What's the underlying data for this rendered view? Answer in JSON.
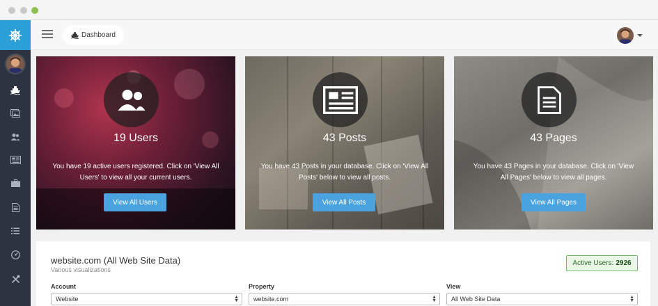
{
  "header": {
    "breadcrumb_icon": "ship-icon",
    "breadcrumb_label": "Dashboard"
  },
  "sidebar": {
    "brand_icon": "ship-wheel-icon",
    "items": [
      {
        "icon": "ship-icon"
      },
      {
        "icon": "pictures-icon"
      },
      {
        "icon": "users-icon"
      },
      {
        "icon": "newspaper-icon"
      },
      {
        "icon": "briefcase-icon"
      },
      {
        "icon": "document-icon"
      },
      {
        "icon": "list-icon"
      },
      {
        "icon": "dashboard-gauge-icon"
      },
      {
        "icon": "tools-icon"
      }
    ]
  },
  "cards": [
    {
      "title": "19 Users",
      "description": "You have 19 active users registered. Click on 'View All Users' to view all your current users.",
      "button": "View All Users",
      "icon": "users-icon"
    },
    {
      "title": "43 Posts",
      "description": "You have 43 Posts in your database. Click on 'View All Posts' below to view all posts.",
      "button": "View All Posts",
      "icon": "newspaper-icon"
    },
    {
      "title": "43 Pages",
      "description": "You have 43 Pages in your database. Click on 'View All Pages' below to view all pages.",
      "button": "View All Pages",
      "icon": "document-icon"
    }
  ],
  "analytics": {
    "title": "website.com (All Web Site Data)",
    "subtitle": "Various visualizations",
    "active_users_label": "Active Users:",
    "active_users_value": "2926",
    "account_label": "Account",
    "account_value": "Website",
    "property_label": "Property",
    "property_value": "website.com",
    "view_label": "View",
    "view_value": "All Web Site Data"
  },
  "colors": {
    "brand": "#2a9fd8",
    "sidebar": "#2b3440",
    "button": "#4aa3df",
    "active_border": "#6dbb63"
  }
}
